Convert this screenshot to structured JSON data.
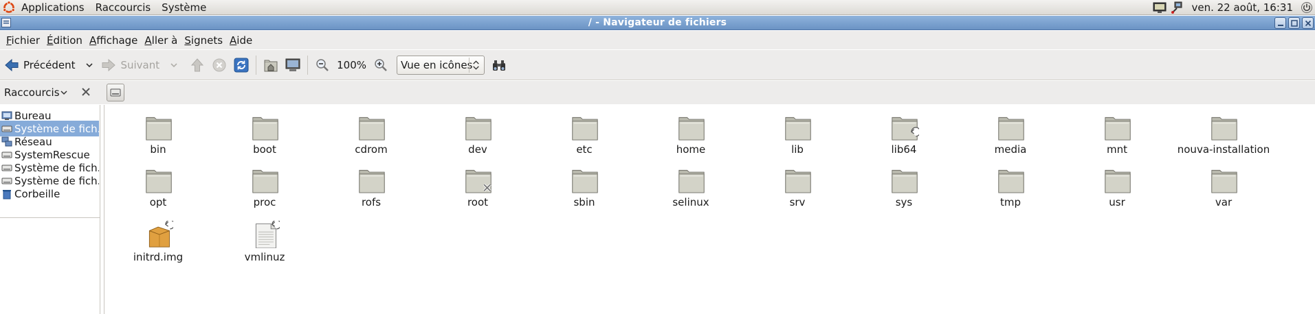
{
  "top_panel": {
    "menus": [
      "Applications",
      "Raccourcis",
      "Système"
    ],
    "clock": "ven. 22 août, 16:31"
  },
  "window": {
    "title": "/ - Navigateur de fichiers"
  },
  "menubar": [
    "Fichier",
    "Édition",
    "Affichage",
    "Aller à",
    "Signets",
    "Aide"
  ],
  "toolbar": {
    "back_label": "Précédent",
    "forward_label": "Suivant",
    "zoom_level": "100%",
    "view_mode": "Vue en icônes"
  },
  "side_pane": {
    "title": "Raccourcis",
    "items": [
      {
        "label": "Bureau",
        "icon": "desktop-icon",
        "selected": false
      },
      {
        "label": "Système de fich...",
        "icon": "drive-icon",
        "selected": true
      },
      {
        "label": "Réseau",
        "icon": "network-icon",
        "selected": false
      },
      {
        "label": "SystemRescue",
        "icon": "drive-icon",
        "selected": false
      },
      {
        "label": "Système de fich...",
        "icon": "drive-icon",
        "selected": false
      },
      {
        "label": "Système de fich...",
        "icon": "drive-icon",
        "selected": false
      },
      {
        "label": "Corbeille",
        "icon": "trash-icon",
        "selected": false
      }
    ]
  },
  "files": [
    {
      "name": "bin",
      "type": "folder"
    },
    {
      "name": "boot",
      "type": "folder"
    },
    {
      "name": "cdrom",
      "type": "folder"
    },
    {
      "name": "dev",
      "type": "folder"
    },
    {
      "name": "etc",
      "type": "folder"
    },
    {
      "name": "home",
      "type": "folder"
    },
    {
      "name": "lib",
      "type": "folder"
    },
    {
      "name": "lib64",
      "type": "folder-link"
    },
    {
      "name": "media",
      "type": "folder"
    },
    {
      "name": "mnt",
      "type": "folder"
    },
    {
      "name": "nouva-installation",
      "type": "folder"
    },
    {
      "name": "opt",
      "type": "folder"
    },
    {
      "name": "proc",
      "type": "folder"
    },
    {
      "name": "rofs",
      "type": "folder"
    },
    {
      "name": "root",
      "type": "folder-locked"
    },
    {
      "name": "sbin",
      "type": "folder"
    },
    {
      "name": "selinux",
      "type": "folder"
    },
    {
      "name": "srv",
      "type": "folder"
    },
    {
      "name": "sys",
      "type": "folder"
    },
    {
      "name": "tmp",
      "type": "folder"
    },
    {
      "name": "usr",
      "type": "folder"
    },
    {
      "name": "var",
      "type": "folder"
    },
    {
      "name": "initrd.img",
      "type": "package-link"
    },
    {
      "name": "vmlinuz",
      "type": "document-link"
    }
  ],
  "colors": {
    "title_bar": "#7aa0cf",
    "selection": "#86abd9",
    "folder": "#cfcfc4"
  }
}
